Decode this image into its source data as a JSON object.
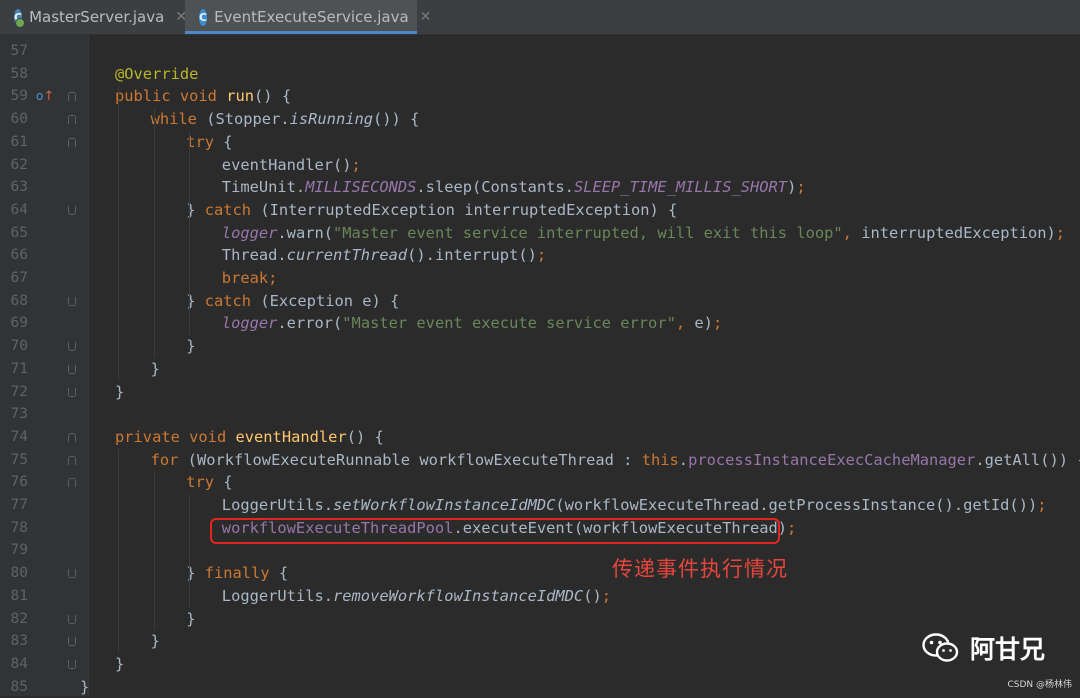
{
  "tabs": [
    {
      "label": "MasterServer.java",
      "icon": "java-class-icon",
      "active": false
    },
    {
      "label": "EventExecuteService.java",
      "icon": "java-class-icon",
      "active": true
    }
  ],
  "tab_icon_letter": "C",
  "close_glyph": "✕",
  "lines": [
    {
      "n": "57",
      "indent": 0,
      "tokens": []
    },
    {
      "n": "58",
      "indent": 1,
      "tokens": [
        [
          "ann",
          "@Override"
        ]
      ]
    },
    {
      "n": "59",
      "indent": 1,
      "tokens": [
        [
          "kw",
          "public "
        ],
        [
          "kw",
          "void "
        ],
        [
          "fn",
          "run"
        ],
        [
          "pl",
          "() {"
        ]
      ]
    },
    {
      "n": "60",
      "indent": 2,
      "tokens": [
        [
          "kw",
          "while "
        ],
        [
          "pl",
          "(Stopper."
        ],
        [
          "pli",
          "isRunning"
        ],
        [
          "pl",
          "()) {"
        ]
      ]
    },
    {
      "n": "61",
      "indent": 3,
      "tokens": [
        [
          "kw",
          "try "
        ],
        [
          "pl",
          "{"
        ]
      ]
    },
    {
      "n": "62",
      "indent": 4,
      "tokens": [
        [
          "pl",
          "eventHandler()"
        ],
        [
          "kw",
          ";"
        ]
      ]
    },
    {
      "n": "63",
      "indent": 4,
      "tokens": [
        [
          "pl",
          "TimeUnit."
        ],
        [
          "fldi",
          "MILLISECONDS"
        ],
        [
          "pl",
          ".sleep(Constants."
        ],
        [
          "fldi",
          "SLEEP_TIME_MILLIS_SHORT"
        ],
        [
          "pl",
          ")"
        ],
        [
          "kw",
          ";"
        ]
      ]
    },
    {
      "n": "64",
      "indent": 3,
      "tokens": [
        [
          "pl",
          "} "
        ],
        [
          "kw",
          "catch "
        ],
        [
          "pl",
          "(InterruptedException interruptedException) {"
        ]
      ]
    },
    {
      "n": "65",
      "indent": 4,
      "tokens": [
        [
          "fldi",
          "logger"
        ],
        [
          "pl",
          ".warn("
        ],
        [
          "str",
          "\"Master event service interrupted, will exit this loop\""
        ],
        [
          "kw",
          ", "
        ],
        [
          "pl",
          "interruptedException)"
        ],
        [
          "kw",
          ";"
        ]
      ]
    },
    {
      "n": "66",
      "indent": 4,
      "tokens": [
        [
          "pl",
          "Thread."
        ],
        [
          "pli",
          "currentThread"
        ],
        [
          "pl",
          "().interrupt()"
        ],
        [
          "kw",
          ";"
        ]
      ]
    },
    {
      "n": "67",
      "indent": 4,
      "tokens": [
        [
          "kw",
          "break;"
        ]
      ]
    },
    {
      "n": "68",
      "indent": 3,
      "tokens": [
        [
          "pl",
          "} "
        ],
        [
          "kw",
          "catch "
        ],
        [
          "pl",
          "(Exception e) {"
        ]
      ]
    },
    {
      "n": "69",
      "indent": 4,
      "tokens": [
        [
          "fldi",
          "logger"
        ],
        [
          "pl",
          ".error("
        ],
        [
          "str",
          "\"Master event execute service error\""
        ],
        [
          "kw",
          ", "
        ],
        [
          "pl",
          "e)"
        ],
        [
          "kw",
          ";"
        ]
      ]
    },
    {
      "n": "70",
      "indent": 3,
      "tokens": [
        [
          "pl",
          "}"
        ]
      ]
    },
    {
      "n": "71",
      "indent": 2,
      "tokens": [
        [
          "pl",
          "}"
        ]
      ]
    },
    {
      "n": "72",
      "indent": 1,
      "tokens": [
        [
          "pl",
          "}"
        ]
      ]
    },
    {
      "n": "73",
      "indent": 0,
      "tokens": []
    },
    {
      "n": "74",
      "indent": 1,
      "tokens": [
        [
          "kw",
          "private "
        ],
        [
          "kw",
          "void "
        ],
        [
          "fn",
          "eventHandler"
        ],
        [
          "pl",
          "() {"
        ]
      ]
    },
    {
      "n": "75",
      "indent": 2,
      "tokens": [
        [
          "kw",
          "for "
        ],
        [
          "pl",
          "(WorkflowExecuteRunnable workflowExecuteThread : "
        ],
        [
          "kw",
          "this"
        ],
        [
          "pl",
          "."
        ],
        [
          "fld",
          "processInstanceExecCacheManager"
        ],
        [
          "pl",
          ".getAll()) {"
        ]
      ]
    },
    {
      "n": "76",
      "indent": 3,
      "tokens": [
        [
          "kw",
          "try "
        ],
        [
          "pl",
          "{"
        ]
      ]
    },
    {
      "n": "77",
      "indent": 4,
      "tokens": [
        [
          "pl",
          "LoggerUtils."
        ],
        [
          "pli",
          "setWorkflowInstanceIdMDC"
        ],
        [
          "pl",
          "(workflowExecuteThread.getProcessInstance().getId())"
        ],
        [
          "kw",
          ";"
        ]
      ]
    },
    {
      "n": "78",
      "indent": 4,
      "tokens": [
        [
          "fld",
          "workflowExecuteThreadPool"
        ],
        [
          "pl",
          ".executeEvent(workflowExecuteThread)"
        ],
        [
          "kw",
          ";"
        ]
      ]
    },
    {
      "n": "79",
      "indent": 0,
      "tokens": []
    },
    {
      "n": "80",
      "indent": 3,
      "tokens": [
        [
          "pl",
          "} "
        ],
        [
          "kw",
          "finally "
        ],
        [
          "pl",
          "{"
        ]
      ]
    },
    {
      "n": "81",
      "indent": 4,
      "tokens": [
        [
          "pl",
          "LoggerUtils."
        ],
        [
          "pli",
          "removeWorkflowInstanceIdMDC"
        ],
        [
          "pl",
          "()"
        ],
        [
          "kw",
          ";"
        ]
      ]
    },
    {
      "n": "82",
      "indent": 3,
      "tokens": [
        [
          "pl",
          "}"
        ]
      ]
    },
    {
      "n": "83",
      "indent": 2,
      "tokens": [
        [
          "pl",
          "}"
        ]
      ]
    },
    {
      "n": "84",
      "indent": 1,
      "tokens": [
        [
          "pl",
          "}"
        ]
      ]
    },
    {
      "n": "85",
      "indent": 0,
      "tokens": [
        [
          "pl",
          "}"
        ]
      ]
    }
  ],
  "folds": {
    "59": "start",
    "60": "start",
    "61": "start",
    "64": "end",
    "68": "end",
    "70": "end",
    "71": "end",
    "72": "end",
    "74": "start",
    "75": "start",
    "76": "start",
    "80": "end",
    "82": "end",
    "83": "end",
    "84": "end"
  },
  "override_marker": {
    "line": "59",
    "icon": "override-icon",
    "glyph": "o",
    "arrow": "↑"
  },
  "annotation": {
    "text": "传递事件执行情况",
    "color": "#e8453c"
  },
  "watermark": {
    "name": "阿甘兄",
    "source": "CSDN @杨林伟"
  },
  "colors": {
    "background": "#2b2b2b",
    "keyword": "#cc7832",
    "annotation": "#bbb529",
    "method": "#ffc66d",
    "string": "#6a8759",
    "field": "#9876aa",
    "plain": "#a9b7c6",
    "highlight_box": "#e0261e"
  }
}
